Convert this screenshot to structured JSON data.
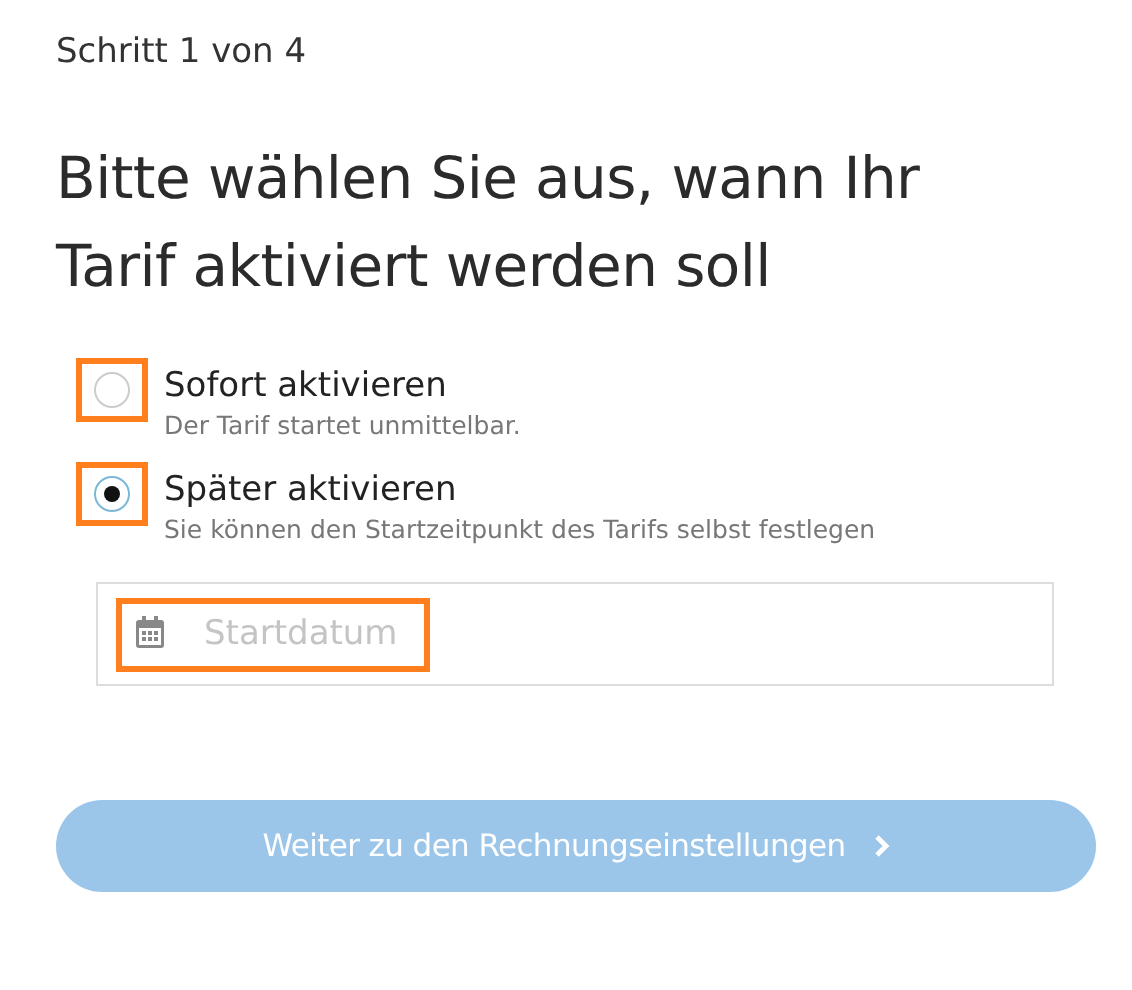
{
  "step": "Schritt 1 von 4",
  "heading": "Bitte wählen Sie aus, wann Ihr Tarif aktiviert werden soll",
  "options": [
    {
      "label": "Sofort aktivieren",
      "description": "Der Tarif startet unmittelbar.",
      "selected": false,
      "highlighted": true
    },
    {
      "label": "Später aktivieren",
      "description": "Sie können den Startzeitpunkt des Tarifs selbst festlegen",
      "selected": true,
      "highlighted": true
    }
  ],
  "date_field": {
    "placeholder": "Startdatum",
    "highlighted": true
  },
  "button": {
    "label": "Weiter zu den Rechnungseinstellungen",
    "disabled": true
  }
}
